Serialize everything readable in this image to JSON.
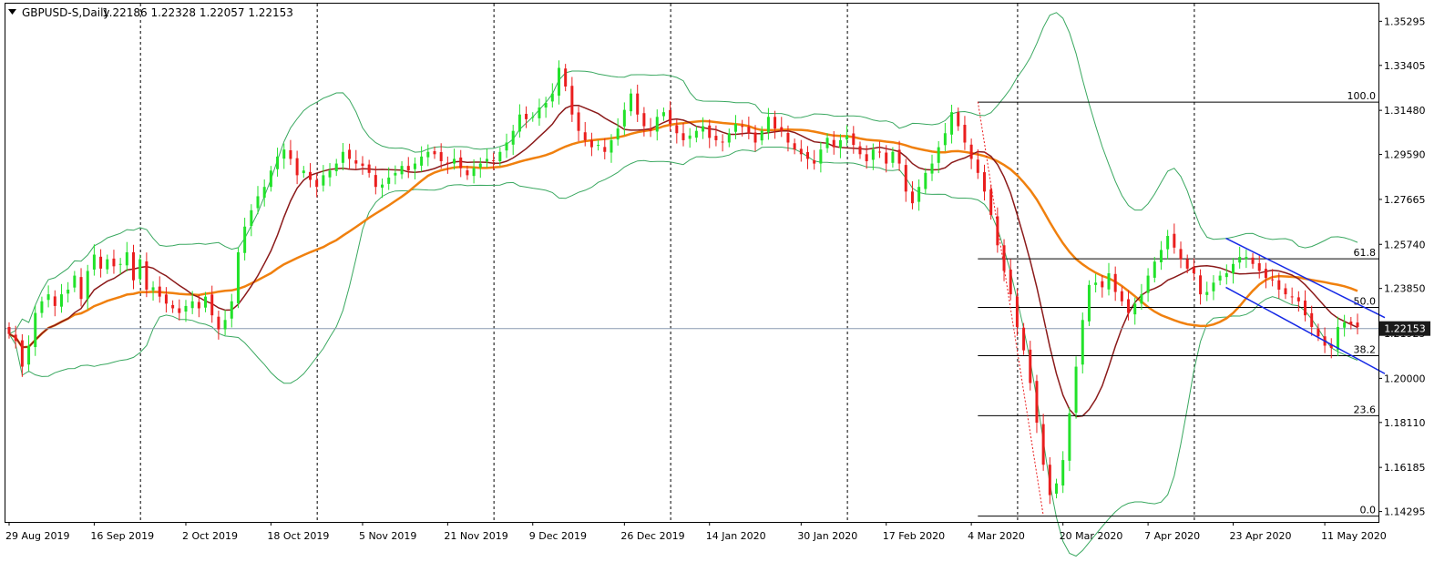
{
  "window": {
    "title": "GBPUSD-S,Daily",
    "ohlc": "1.22186 1.22328 1.22057 1.22153",
    "current_price_label": "1.22153"
  },
  "colors": {
    "background": "#ffffff",
    "grid": "#000000",
    "bull_candle": "#22e22a",
    "bear_candle": "#ea1e1e",
    "ma_fast": "#8b1a1a",
    "ma_slow": "#f0800e",
    "bollinger": "#3aa860",
    "channel": "#1428e6",
    "fib_lines": "#000000",
    "price_badge_bg": "#1a1a1a",
    "price_badge_text": "#ffffff"
  },
  "chart_data": {
    "type": "candlestick",
    "instrument": "GBPUSD-S",
    "timeframe": "Daily",
    "y_ticks": [
      "1.35295",
      "1.33405",
      "1.31480",
      "1.29590",
      "1.27665",
      "1.25740",
      "1.23850",
      "1.21925",
      "1.20000",
      "1.18110",
      "1.16185",
      "1.14295"
    ],
    "x_ticks": [
      "29 Aug 2019",
      "16 Sep 2019",
      "2 Oct 2019",
      "18 Oct 2019",
      "5 Nov 2019",
      "21 Nov 2019",
      "9 Dec 2019",
      "26 Dec 2019",
      "14 Jan 2020",
      "30 Jan 2020",
      "17 Feb 2020",
      "4 Mar 2020",
      "20 Mar 2020",
      "7 Apr 2020",
      "23 Apr 2020",
      "11 May 2020"
    ],
    "ylim": [
      1.1385,
      1.3605
    ],
    "fibonacci": [
      {
        "label": "100.0",
        "value": 1.3185
      },
      {
        "label": "61.8",
        "value": 1.2514
      },
      {
        "label": "50.0",
        "value": 1.2306
      },
      {
        "label": "38.2",
        "value": 1.2099
      },
      {
        "label": "23.6",
        "value": 1.1842
      },
      {
        "label": "0.0",
        "value": 1.1412
      }
    ],
    "current_price": 1.22153,
    "series": [
      {
        "name": "price",
        "style": "candles",
        "closes": [
          1.219,
          1.216,
          1.205,
          1.214,
          1.228,
          1.233,
          1.236,
          1.231,
          1.236,
          1.238,
          1.244,
          1.234,
          1.246,
          1.253,
          1.247,
          1.251,
          1.248,
          1.249,
          1.254,
          1.242,
          1.251,
          1.238,
          1.239,
          1.235,
          1.232,
          1.23,
          1.228,
          1.231,
          1.233,
          1.23,
          1.235,
          1.227,
          1.221,
          1.225,
          1.233,
          1.254,
          1.265,
          1.272,
          1.278,
          1.282,
          1.289,
          1.295,
          1.298,
          1.294,
          1.287,
          1.289,
          1.285,
          1.282,
          1.287,
          1.289,
          1.292,
          1.297,
          1.294,
          1.292,
          1.291,
          1.288,
          1.282,
          1.283,
          1.286,
          1.288,
          1.291,
          1.289,
          1.292,
          1.295,
          1.297,
          1.296,
          1.293,
          1.292,
          1.294,
          1.29,
          1.287,
          1.29,
          1.292,
          1.294,
          1.293,
          1.297,
          1.301,
          1.306,
          1.313,
          1.311,
          1.312,
          1.316,
          1.318,
          1.322,
          1.333,
          1.325,
          1.313,
          1.306,
          1.302,
          1.299,
          1.3,
          1.297,
          1.302,
          1.307,
          1.315,
          1.322,
          1.313,
          1.308,
          1.306,
          1.312,
          1.314,
          1.309,
          1.305,
          1.302,
          1.304,
          1.306,
          1.308,
          1.303,
          1.302,
          1.301,
          1.305,
          1.309,
          1.308,
          1.305,
          1.301,
          1.306,
          1.312,
          1.307,
          1.306,
          1.301,
          1.298,
          1.296,
          1.294,
          1.292,
          1.298,
          1.303,
          1.299,
          1.302,
          1.304,
          1.3,
          1.296,
          1.293,
          1.298,
          1.297,
          1.292,
          1.297,
          1.292,
          1.28,
          1.275,
          1.282,
          1.288,
          1.292,
          1.299,
          1.305,
          1.314,
          1.308,
          1.301,
          1.294,
          1.288,
          1.28,
          1.27,
          1.257,
          1.246,
          1.236,
          1.222,
          1.212,
          1.198,
          1.181,
          1.163,
          1.15,
          1.155,
          1.165,
          1.185,
          1.205,
          1.225,
          1.24,
          1.241,
          1.239,
          1.245,
          1.237,
          1.233,
          1.228,
          1.232,
          1.236,
          1.244,
          1.25,
          1.255,
          1.261,
          1.256,
          1.251,
          1.247,
          1.245,
          1.236,
          1.237,
          1.241,
          1.244,
          1.245,
          1.249,
          1.252,
          1.252,
          1.249,
          1.246,
          1.243,
          1.242,
          1.238,
          1.236,
          1.235,
          1.233,
          1.227,
          1.222,
          1.218,
          1.214,
          1.213,
          1.222,
          1.224,
          1.223,
          1.222
        ]
      },
      {
        "name": "ma_fast",
        "style": "line"
      },
      {
        "name": "ma_slow",
        "style": "line"
      },
      {
        "name": "bollinger_upper",
        "style": "line"
      },
      {
        "name": "bollinger_lower",
        "style": "line"
      }
    ],
    "channel": {
      "upper": [
        [
          "23 Apr 2020",
          1.26
        ],
        [
          "18 May 2020",
          1.226
        ]
      ],
      "lower": [
        [
          "23 Apr 2020",
          1.239
        ],
        [
          "18 May 2020",
          1.202
        ]
      ]
    }
  }
}
